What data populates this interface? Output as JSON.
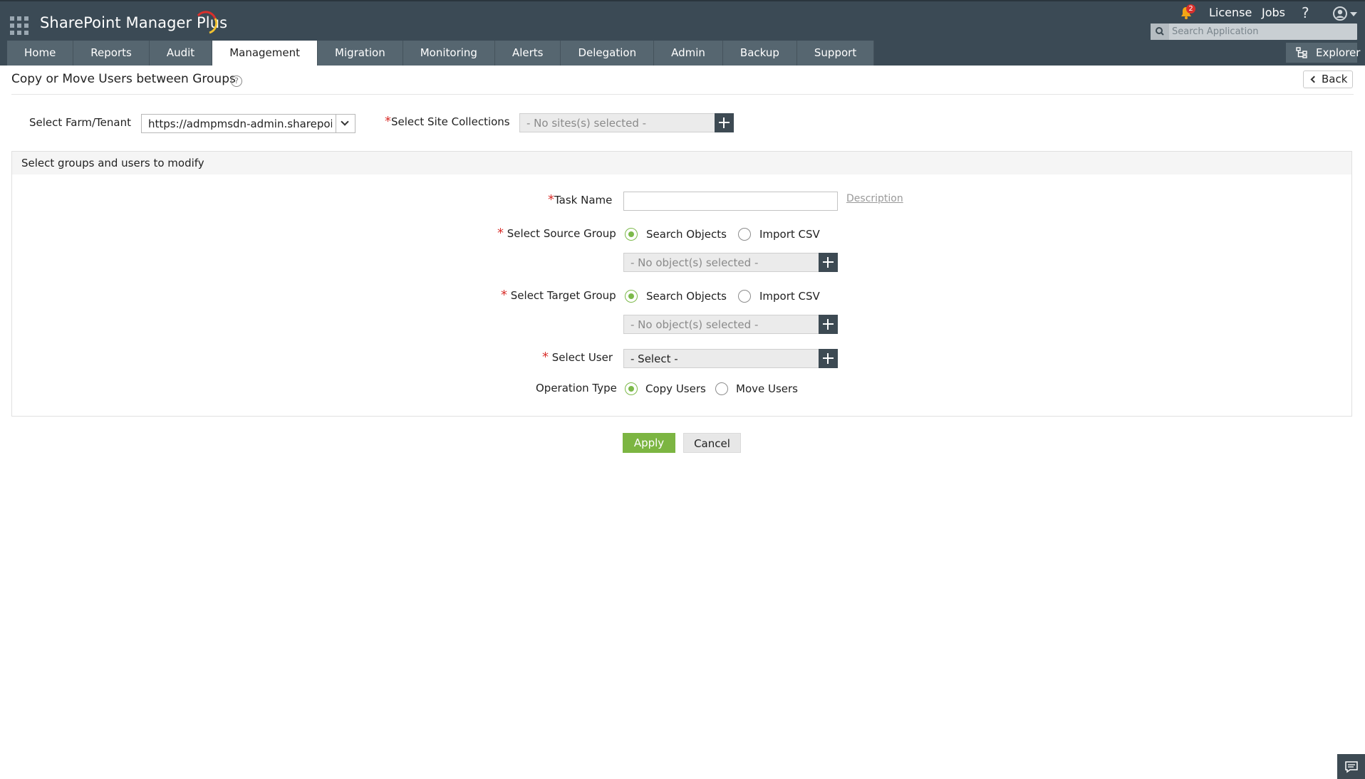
{
  "app": {
    "name": "SharePoint Manager Plus",
    "colors": {
      "header_bg": "#3b4a55",
      "tab_bg": "#566670",
      "accent_green": "#7cb542",
      "required": "#d9302c"
    }
  },
  "header": {
    "notification_count": "2",
    "links": {
      "license": "License",
      "jobs": "Jobs",
      "help": "?"
    },
    "search": {
      "placeholder": "Search Application",
      "value": ""
    },
    "explorer_label": "Explorer"
  },
  "nav": {
    "tabs": [
      {
        "label": "Home",
        "active": false
      },
      {
        "label": "Reports",
        "active": false
      },
      {
        "label": "Audit",
        "active": false
      },
      {
        "label": "Management",
        "active": true
      },
      {
        "label": "Migration",
        "active": false
      },
      {
        "label": "Monitoring",
        "active": false
      },
      {
        "label": "Alerts",
        "active": false
      },
      {
        "label": "Delegation",
        "active": false
      },
      {
        "label": "Admin",
        "active": false
      },
      {
        "label": "Backup",
        "active": false
      },
      {
        "label": "Support",
        "active": false
      }
    ]
  },
  "page": {
    "title": "Copy or Move Users between Groups",
    "help_glyph": "?",
    "back_label": "Back"
  },
  "form_top": {
    "farm_label": "Select Farm/Tenant",
    "farm_value": "https://admpmsdn-admin.sharepoint",
    "site_label": "Select Site Collections",
    "site_value": "- No sites(s) selected -"
  },
  "panel": {
    "heading": "Select groups and users to modify",
    "task_name_label": "Task Name",
    "task_name_value": "",
    "description_link": "Description",
    "source_group": {
      "label": "Select Source Group",
      "options": [
        "Search Objects",
        "Import CSV"
      ],
      "selected": "Search Objects",
      "picker_value": "- No object(s) selected -"
    },
    "target_group": {
      "label": "Select Target Group",
      "options": [
        "Search Objects",
        "Import CSV"
      ],
      "selected": "Search Objects",
      "picker_value": "- No object(s) selected -"
    },
    "select_user": {
      "label": "Select User",
      "picker_value": "- Select -"
    },
    "operation_type": {
      "label": "Operation Type",
      "options": [
        "Copy Users",
        "Move Users"
      ],
      "selected": "Copy Users"
    }
  },
  "actions": {
    "apply": "Apply",
    "cancel": "Cancel"
  },
  "required_mark": "*"
}
